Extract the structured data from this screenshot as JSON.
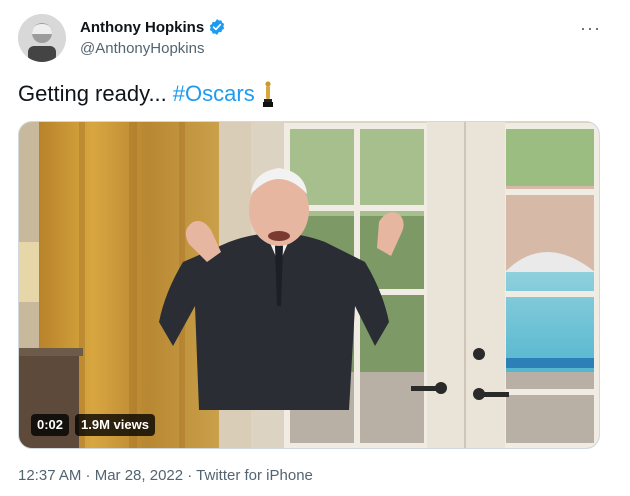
{
  "author": {
    "display_name": "Anthony Hopkins",
    "handle": "@AnthonyHopkins",
    "verified": true
  },
  "tweet": {
    "text_plain": "Getting ready...",
    "hashtag": "#Oscars",
    "emoji_icon": "oscar-trophy-icon"
  },
  "media": {
    "duration": "0:02",
    "views": "1.9M views"
  },
  "meta": {
    "timestamp": "12:37 AM · Mar 28, 2022 · Twitter for iPhone"
  },
  "colors": {
    "accent": "#1d9bf0",
    "secondary_text": "#536471"
  }
}
